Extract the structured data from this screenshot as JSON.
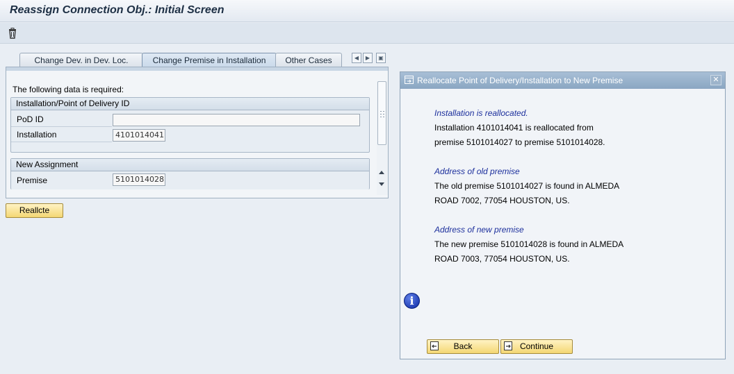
{
  "window": {
    "title": "Reassign Connection Obj.: Initial Screen"
  },
  "toolbar": {
    "delete_icon": "trash-icon"
  },
  "tabs": [
    {
      "label": "Change Dev. in Dev. Loc.",
      "active": false
    },
    {
      "label": "Change Premise in Installation",
      "active": true
    },
    {
      "label": "Other Cases",
      "active": false
    }
  ],
  "panel": {
    "required_text": "The following data is required:",
    "group1": {
      "title": "Installation/Point of Delivery ID",
      "pod_label": "PoD ID",
      "pod_value": "",
      "installation_label": "Installation",
      "installation_value": "4101014041"
    },
    "group2": {
      "title": "New Assignment",
      "premise_label": "Premise",
      "premise_value": "5101014028"
    }
  },
  "actions": {
    "reallocate_label": "Reallcte"
  },
  "dialog": {
    "title": "Reallocate Point of Delivery/Installation to New Premise",
    "messages": [
      {
        "heading": "Installation is reallocated.",
        "lines": [
          "Installation 4101014041 is reallocated from",
          "premise 5101014027 to premise 5101014028."
        ]
      },
      {
        "heading": "Address of old premise",
        "lines": [
          "The old premise 5101014027 is found in ALMEDA",
          "ROAD 7002, 77054 HOUSTON, US."
        ]
      },
      {
        "heading": "Address of new premise",
        "lines": [
          "The new premise 5101014028 is found in ALMEDA",
          "ROAD 7003, 77054 HOUSTON, US."
        ]
      }
    ],
    "back_label": "Back",
    "continue_label": "Continue"
  },
  "colors": {
    "accent": "#f4d774",
    "dialog_title": "#8aa6c2",
    "message_heading": "#1c2f9c"
  }
}
